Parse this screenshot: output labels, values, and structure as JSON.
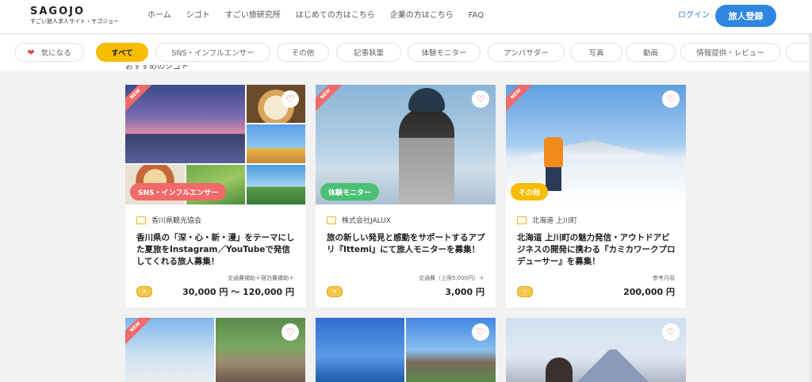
{
  "header": {
    "logo": "SAGOJO",
    "logo_sub": "すごい旅人求人サイト・サゴジョー",
    "nav": [
      "ホーム",
      "シゴト",
      "すごい旅研究所",
      "はじめての方はこちら",
      "企業の方はこちら",
      "FAQ"
    ],
    "login": "ログイン",
    "register": "旅人登録"
  },
  "filters": {
    "favorite": "気になる",
    "items": [
      "すべて",
      "SNS・インフルエンサー",
      "その他",
      "記事執筆",
      "体験モニター",
      "アンバサダー",
      "写真",
      "動画",
      "情報提供・レビュー"
    ]
  },
  "section_title": "おすすめのシゴト",
  "cards": [
    {
      "new": "NEW",
      "tag": "SNS・インフルエンサー",
      "tag_color": "#ef6a6a",
      "org": "香川県観光協会",
      "title": "香川県の「深・心・新・漫」をテーマにした夏旅をInstagram／YouTubeで発信してくれる旅人募集！",
      "note": "交通費補助＋宿泊費補助＋",
      "coin": "¥",
      "price": "30,000 円 〜 120,000 円"
    },
    {
      "new": "NEW",
      "tag": "体験モニター",
      "tag_color": "#4cbf77",
      "org": "株式会社JALUX",
      "title": "旅の新しい発見と感動をサポートするアプリ『Ittemi』にて旅人モニターを募集！",
      "note": "交通費（上限5,000円）＋",
      "coin": "¥",
      "price": "3,000 円"
    },
    {
      "new": "NEW",
      "tag": "その他",
      "tag_color": "#f7bd00",
      "org": "北海道 上川町",
      "title": "北海道 上川町の魅力発信・アウトドアビジネスの開発に携わる『カミカワークプロデューサー』を募集！",
      "note": "参考月収",
      "coin": "¥",
      "price": "200,000 円"
    }
  ],
  "row2": {
    "new": "NEW"
  },
  "icons": {
    "favorite": "heart-icon",
    "org": "building-icon",
    "reward": "coin-icon"
  }
}
